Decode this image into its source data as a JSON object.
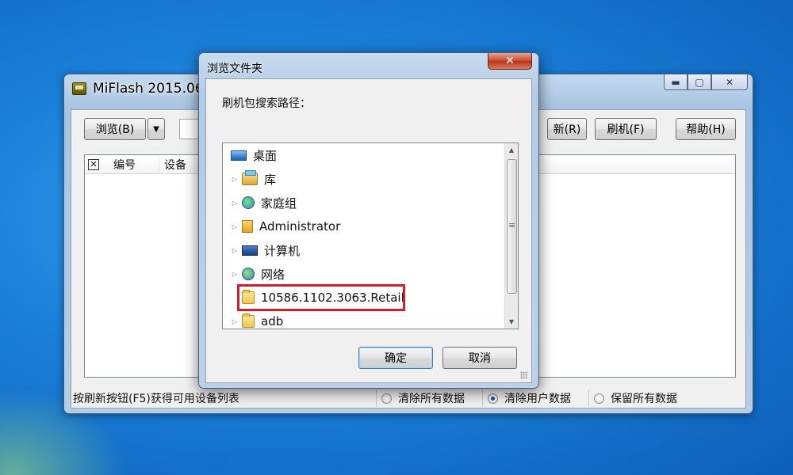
{
  "main_window": {
    "title": "MiFlash 2015.06.0",
    "controls": {
      "minimize": "▬",
      "maximize": "▢",
      "close": "✕"
    },
    "toolbar": {
      "browse_label": "浏览(B)",
      "dropdown_arrow": "▼",
      "refresh_label": "新(R)",
      "flash_label": "刷机(F)",
      "help_label": "帮助(H)"
    },
    "grid": {
      "checkbox_mark": "✕",
      "columns": [
        "编号",
        "设备"
      ]
    },
    "status_text": "按刷新按钮(F5)获得可用设备列表",
    "options": [
      {
        "label": "清除所有数据",
        "selected": false
      },
      {
        "label": "清除用户数据",
        "selected": true
      },
      {
        "label": "保留所有数据",
        "selected": false
      }
    ]
  },
  "dialog": {
    "title": "浏览文件夹",
    "close_glyph": "✕",
    "prompt": "刷机包搜索路径：",
    "tree": [
      {
        "label": "桌面",
        "icon": "desktop-icon"
      },
      {
        "label": "库",
        "icon": "library-icon"
      },
      {
        "label": "家庭组",
        "icon": "homegroup-icon"
      },
      {
        "label": "Administrator",
        "icon": "user-folder-icon"
      },
      {
        "label": "计算机",
        "icon": "computer-icon"
      },
      {
        "label": "网络",
        "icon": "network-icon"
      },
      {
        "label": "10586.1102.3063.Retail",
        "icon": "folder-icon",
        "highlighted": true
      },
      {
        "label": "adb",
        "icon": "folder-icon"
      }
    ],
    "ok_label": "确定",
    "cancel_label": "取消",
    "highlight_color": "#d11f2c"
  }
}
